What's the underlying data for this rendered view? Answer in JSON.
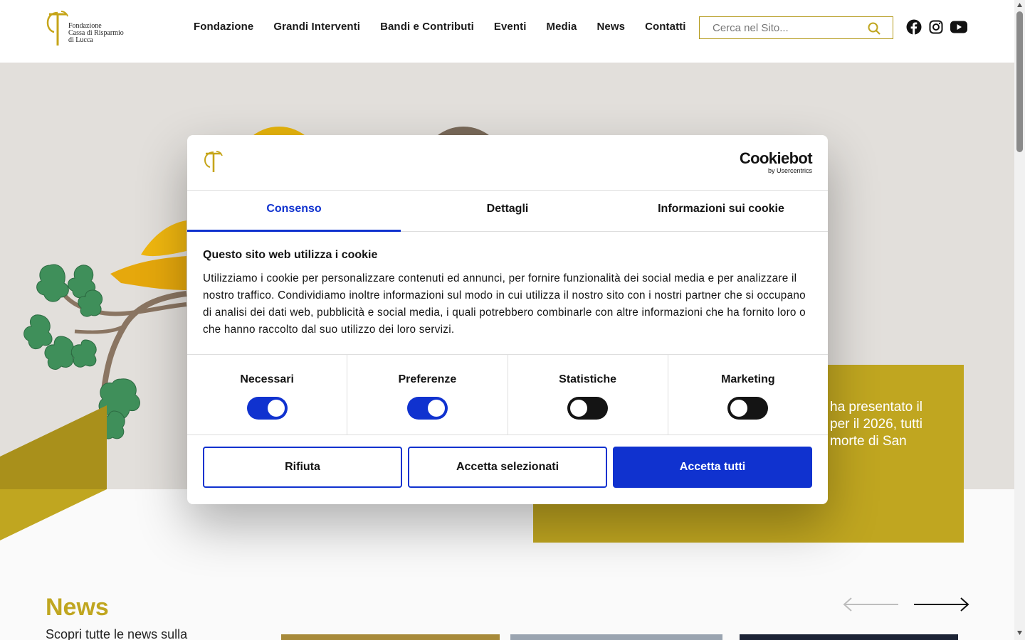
{
  "header": {
    "logo": {
      "icon": "tau-cross-logo",
      "lines": [
        "Fondazione",
        "Cassa di Risparmio",
        "di Lucca"
      ]
    },
    "nav": [
      "Fondazione",
      "Grandi Interventi",
      "Bandi e Contributi",
      "Eventi",
      "Media",
      "News",
      "Contatti"
    ],
    "search": {
      "placeholder": "Cerca nel Sito...",
      "icon": "search-icon"
    },
    "social": [
      "facebook-icon",
      "instagram-icon",
      "youtube-icon"
    ]
  },
  "hero": {
    "text_lines": [
      "ha presentato il",
      "per il 2026, tutti",
      "morte di San"
    ]
  },
  "news": {
    "title": "News",
    "subtitle": "Scopri tutte le news sulla"
  },
  "cookie_dialog": {
    "brand": {
      "name": "Cookiebot",
      "by": "by Usercentrics"
    },
    "tabs": [
      {
        "label": "Consenso",
        "active": true
      },
      {
        "label": "Dettagli",
        "active": false
      },
      {
        "label": "Informazioni sui cookie",
        "active": false
      }
    ],
    "title": "Questo sito web utilizza i cookie",
    "body": "Utilizziamo i cookie per personalizzare contenuti ed annunci, per fornire funzionalità dei social media e per analizzare il nostro traffico. Condividiamo inoltre informazioni sul modo in cui utilizza il nostro sito con i nostri partner che si occupano di analisi dei dati web, pubblicità e social media, i quali potrebbero combinarle con altre informazioni che ha fornito loro o che hanno raccolto dal suo utilizzo dei loro servizi.",
    "toggles": [
      {
        "label": "Necessari",
        "checked": true
      },
      {
        "label": "Preferenze",
        "checked": true
      },
      {
        "label": "Statistiche",
        "checked": false
      },
      {
        "label": "Marketing",
        "checked": false
      }
    ],
    "buttons": {
      "reject": "Rifiuta",
      "accept_selected": "Accetta selezionati",
      "accept_all": "Accetta tutti"
    }
  },
  "colors": {
    "gold": "#c0a620",
    "cookie_blue": "#1032cf",
    "hero_bg": "#e2dfdb",
    "leaf_green": "#3f8f5a"
  }
}
